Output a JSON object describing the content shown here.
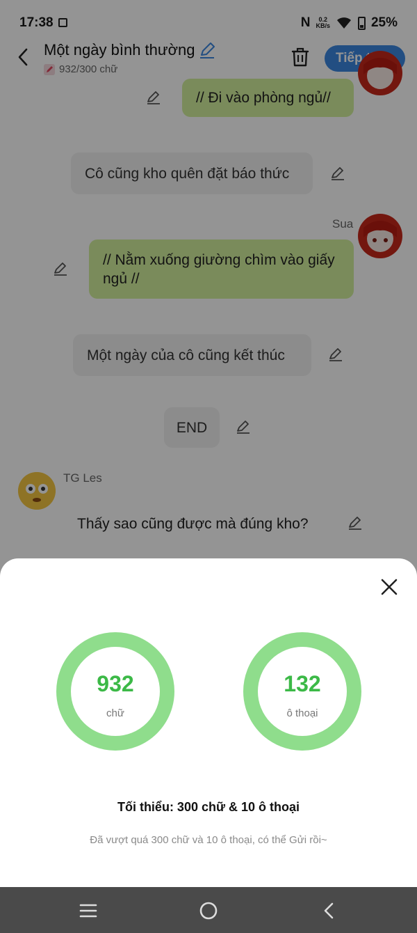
{
  "status_bar": {
    "time": "17:38",
    "net_speed_value": "0.2",
    "net_speed_unit": "KB/s",
    "battery": "25%"
  },
  "header": {
    "title": "Một ngày bình thường",
    "word_count": "932/300 chữ",
    "next_label": "Tiếp theo",
    "accent_color": "#3b87e0"
  },
  "chat": {
    "messages": [
      {
        "text": "// Đi vào phòng ngủ//"
      },
      {
        "text": "Cô cũng kho quên đặt báo thức"
      },
      {
        "sender": "Sua",
        "text": "// Nằm xuống giường chìm vào giấy ngủ //"
      },
      {
        "text": "Một ngày của cô cũng kết thúc"
      },
      {
        "text": "END"
      },
      {
        "sender": "TG Les",
        "text": "Thấy sao cũng được mà đúng kho?"
      }
    ]
  },
  "sheet": {
    "words_value": "932",
    "words_unit": "chữ",
    "dialogs_value": "132",
    "dialogs_unit": "ô thoại",
    "min_requirement": "Tối thiểu: 300 chữ & 10 ô thoại",
    "passed_message": "Đã vượt quá 300 chữ và 10 ô thoại, có thể Gửi rồi~",
    "ring_color": "#8fdd8c",
    "value_color": "#3cb947"
  }
}
